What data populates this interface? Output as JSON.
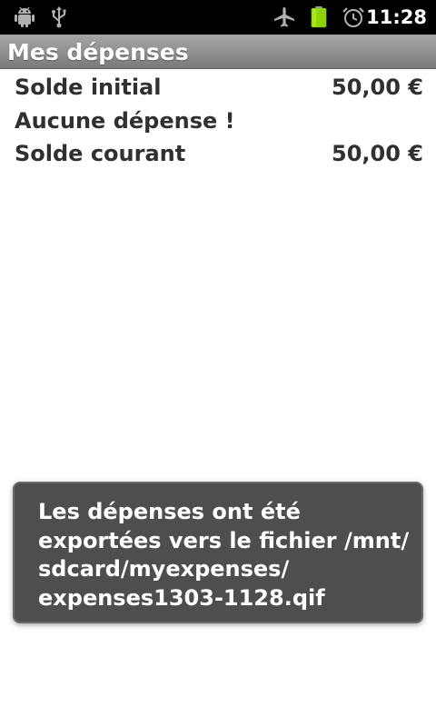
{
  "status_bar": {
    "time": "11:28",
    "icons": [
      "android-debug-icon",
      "usb-icon",
      "airplane-mode-icon",
      "battery-icon",
      "alarm-icon"
    ],
    "battery_color": "#8fd400"
  },
  "title_bar": {
    "title": "Mes dépenses"
  },
  "summary": {
    "initial_label": "Solde initial",
    "initial_value": "50,00 €",
    "empty_message": "Aucune dépense !",
    "current_label": "Solde courant",
    "current_value": "50,00 €"
  },
  "toast": {
    "message": "Les dépenses ont été\nexportées vers le fichier /mnt/\nsdcard/myexpenses/\nexpenses1303-1128.qif"
  }
}
